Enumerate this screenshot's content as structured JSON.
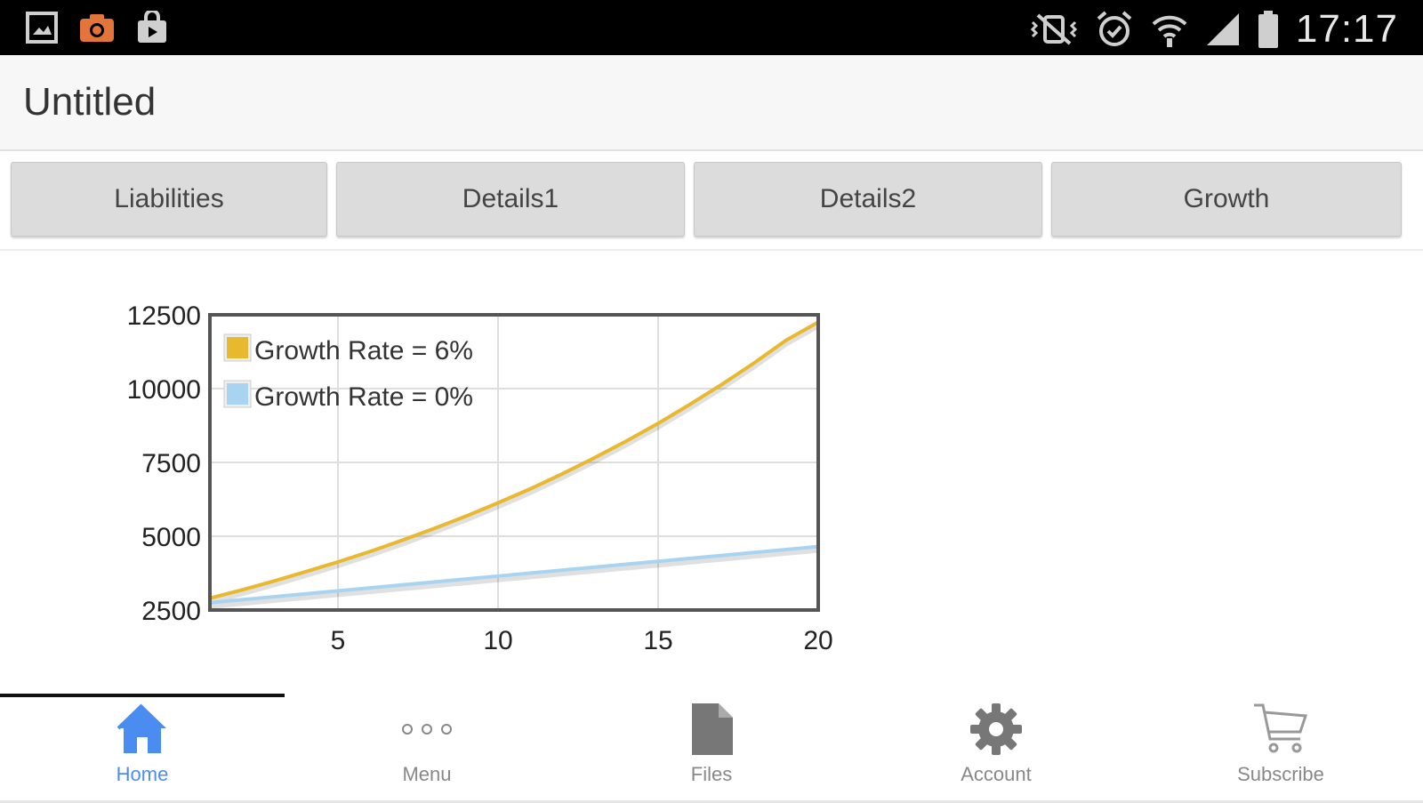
{
  "status_bar": {
    "time": "17:17",
    "left_icons": [
      "gallery-icon",
      "camera-icon",
      "shopping-bag-icon"
    ],
    "right_icons": [
      "vibrate-mute-icon",
      "alarm-icon",
      "wifi-icon",
      "signal-icon",
      "battery-icon"
    ]
  },
  "app_bar": {
    "title": "Untitled"
  },
  "tabs": [
    {
      "label": "Liabilities"
    },
    {
      "label": "Details1"
    },
    {
      "label": "Details2"
    },
    {
      "label": "Growth"
    }
  ],
  "chart_data": {
    "type": "line",
    "title": "",
    "xlabel": "",
    "ylabel": "",
    "xlim": [
      1,
      20
    ],
    "ylim": [
      2500,
      12500
    ],
    "x_ticks": [
      5,
      10,
      15,
      20
    ],
    "y_ticks": [
      2500,
      5000,
      7500,
      10000,
      12500
    ],
    "grid": true,
    "legend_position": "top-left",
    "x": [
      1,
      2,
      3,
      4,
      5,
      6,
      7,
      8,
      9,
      10,
      11,
      12,
      13,
      14,
      15,
      16,
      17,
      18,
      19,
      20
    ],
    "series": [
      {
        "name": "Growth Rate = 6%",
        "color": "#e8b82e",
        "values": [
          2900,
          3180,
          3480,
          3800,
          4130,
          4480,
          4860,
          5260,
          5680,
          6130,
          6600,
          7110,
          7650,
          8220,
          8820,
          9470,
          10150,
          10870,
          11640,
          12250
        ]
      },
      {
        "name": "Growth Rate = 0%",
        "color": "#a8d4f2",
        "values": [
          2750,
          2850,
          2950,
          3050,
          3150,
          3250,
          3350,
          3450,
          3550,
          3650,
          3750,
          3850,
          3950,
          4050,
          4150,
          4250,
          4350,
          4450,
          4550,
          4650
        ]
      }
    ]
  },
  "bottom_nav": {
    "items": [
      {
        "label": "Home",
        "icon": "home-icon",
        "active": true
      },
      {
        "label": "Menu",
        "icon": "more-dots-icon",
        "active": false
      },
      {
        "label": "Files",
        "icon": "file-icon",
        "active": false
      },
      {
        "label": "Account",
        "icon": "gear-icon",
        "active": false
      },
      {
        "label": "Subscribe",
        "icon": "cart-icon",
        "active": false
      }
    ]
  },
  "colors": {
    "accent": "#4a8cf0",
    "tab_bg": "#dcdcdc",
    "status_bar_bg": "#000000",
    "app_bar_bg": "#f7f7f7"
  }
}
